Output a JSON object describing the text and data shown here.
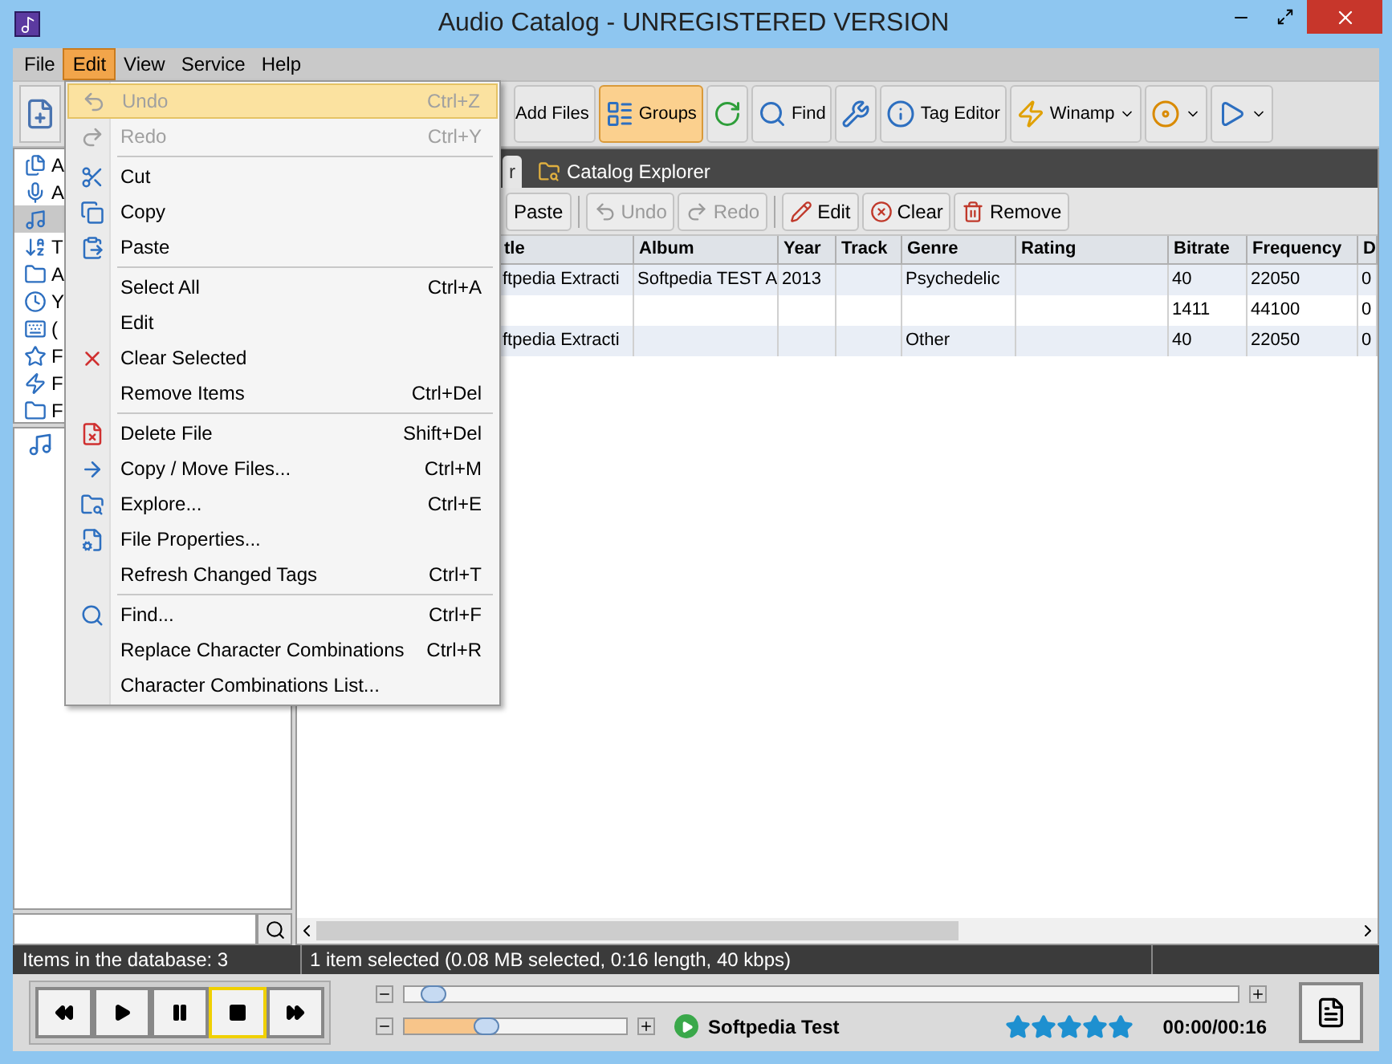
{
  "window": {
    "title": "Audio Catalog - UNREGISTERED VERSION"
  },
  "menu_bar": [
    {
      "label": "File",
      "selected": false
    },
    {
      "label": "Edit",
      "selected": true
    },
    {
      "label": "View",
      "selected": false
    },
    {
      "label": "Service",
      "selected": false
    },
    {
      "label": "Help",
      "selected": false
    }
  ],
  "toolbar": [
    {
      "kind": "text",
      "label": "Add Files",
      "selected": false
    },
    {
      "kind": "icon-text",
      "label": "Groups",
      "selected": true
    },
    {
      "kind": "icon",
      "selected": false
    },
    {
      "kind": "icon-text",
      "label": "Find",
      "selected": false
    },
    {
      "kind": "icon",
      "selected": false
    },
    {
      "kind": "icon-text",
      "label": "Tag Editor",
      "selected": false
    },
    {
      "kind": "dropdown",
      "label": "Winamp",
      "selected": false
    },
    {
      "kind": "dropdown",
      "selected": false
    },
    {
      "kind": "dropdown",
      "selected": false
    }
  ],
  "tree": [
    {
      "label": "A",
      "selected": false
    },
    {
      "label": "A",
      "selected": false
    },
    {
      "selected": true
    },
    {
      "label": "T",
      "selected": false
    },
    {
      "label": "A",
      "selected": false
    },
    {
      "label": "Y",
      "selected": false
    },
    {
      "label": "(",
      "selected": false
    },
    {
      "label": "F",
      "selected": false
    },
    {
      "label": "F",
      "selected": false
    },
    {
      "label": "F",
      "selected": false
    }
  ],
  "tabs": [
    {
      "label": "r",
      "selected": true
    },
    {
      "label": "Catalog Explorer",
      "selected": false
    }
  ],
  "grid_toolbar": [
    {
      "label": "Paste",
      "disabled": false
    },
    {
      "kind": "separator"
    },
    {
      "label": "Undo",
      "disabled": true
    },
    {
      "label": "Redo",
      "disabled": true
    },
    {
      "kind": "separator"
    },
    {
      "label": "Edit",
      "disabled": false
    },
    {
      "label": "Clear",
      "disabled": false
    },
    {
      "label": "Remove",
      "disabled": false
    }
  ],
  "table": {
    "columns": [
      "tle",
      "Album",
      "Year",
      "Track",
      "Genre",
      "Rating",
      "Bitrate",
      "Frequency",
      "D"
    ],
    "rows": [
      [
        "ftpedia Extracti",
        "Softpedia TEST A",
        "2013",
        "",
        "Psychedelic",
        "",
        "40",
        "22050",
        "0"
      ],
      [
        "",
        "",
        "",
        "",
        "",
        "",
        "1411",
        "44100",
        "0"
      ],
      [
        "ftpedia Extracti",
        "",
        "",
        "",
        "Other",
        "",
        "40",
        "22050",
        "0"
      ]
    ]
  },
  "edit_menu": [
    {
      "label": "Undo",
      "shortcut": "Ctrl+Z",
      "disabled": true,
      "selected": true
    },
    {
      "label": "Redo",
      "shortcut": "Ctrl+Y",
      "disabled": true,
      "selected": false
    },
    {
      "kind": "separator"
    },
    {
      "label": "Cut",
      "disabled": false,
      "selected": false
    },
    {
      "label": "Copy",
      "disabled": false,
      "selected": false
    },
    {
      "label": "Paste",
      "disabled": false,
      "selected": false
    },
    {
      "kind": "separator"
    },
    {
      "label": "Select All",
      "shortcut": "Ctrl+A",
      "disabled": false,
      "selected": false
    },
    {
      "label": "Edit",
      "disabled": false,
      "selected": false
    },
    {
      "label": "Clear Selected",
      "disabled": false,
      "selected": false
    },
    {
      "label": "Remove Items",
      "shortcut": "Ctrl+Del",
      "disabled": false,
      "selected": false
    },
    {
      "kind": "separator"
    },
    {
      "label": "Delete File",
      "shortcut": "Shift+Del",
      "disabled": false,
      "selected": false
    },
    {
      "label": "Copy / Move Files...",
      "shortcut": "Ctrl+M",
      "disabled": false,
      "selected": false
    },
    {
      "label": "Explore...",
      "shortcut": "Ctrl+E",
      "disabled": false,
      "selected": false
    },
    {
      "label": "File Properties...",
      "disabled": false,
      "selected": false
    },
    {
      "label": "Refresh Changed Tags",
      "shortcut": "Ctrl+T",
      "disabled": false,
      "selected": false
    },
    {
      "kind": "separator"
    },
    {
      "label": "Find...",
      "shortcut": "Ctrl+F",
      "disabled": false,
      "selected": false
    },
    {
      "label": "Replace Character Combinations",
      "shortcut": "Ctrl+R",
      "disabled": false,
      "selected": false
    },
    {
      "label": "Character Combinations List...",
      "disabled": false,
      "selected": false
    }
  ],
  "status_bar": [
    "Items in the database: 3",
    "1 item selected (0.08 MB selected, 0:16 length, 40 kbps)"
  ],
  "player": {
    "transport": [
      {
        "kind": "rewind",
        "selected": false
      },
      {
        "kind": "play",
        "selected": false
      },
      {
        "kind": "pause",
        "selected": false
      },
      {
        "kind": "stop",
        "selected": true
      },
      {
        "kind": "forward",
        "selected": false
      }
    ],
    "position": {
      "level": 0.02
    },
    "volume": {
      "level": 0.35
    },
    "track": "Softpedia Test",
    "stars": 5,
    "time": "00:00/00:16"
  }
}
